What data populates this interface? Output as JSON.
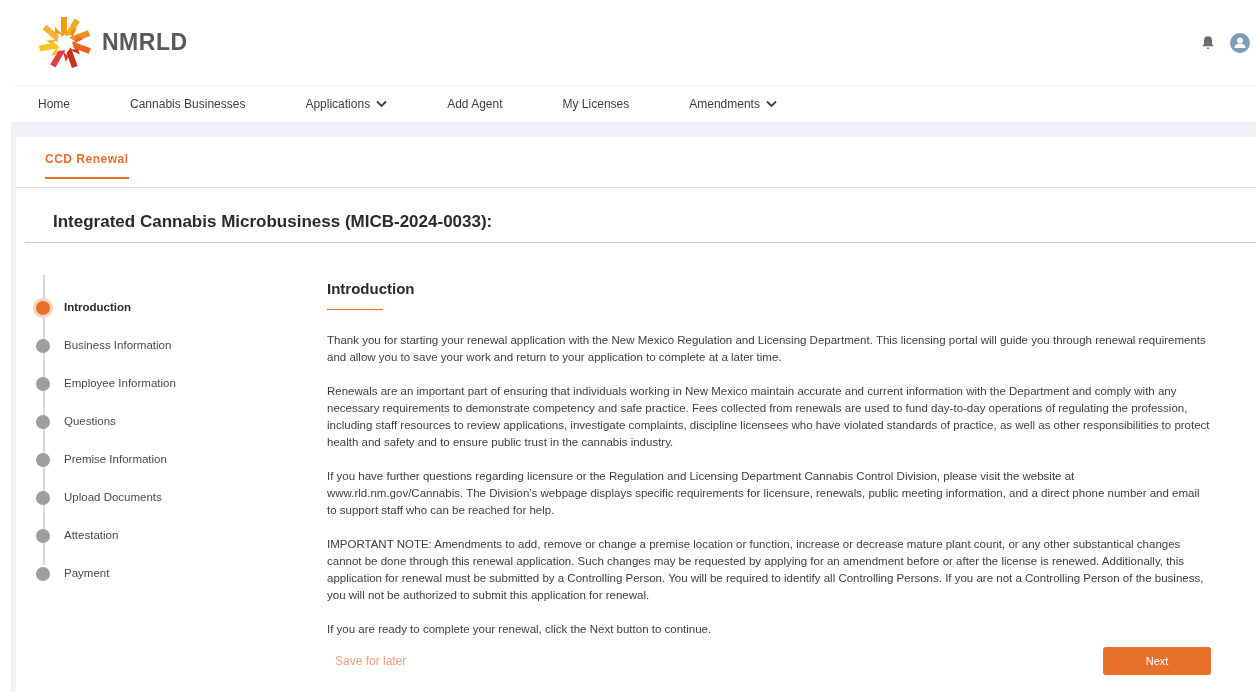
{
  "header": {
    "logo_text": "NMRLD"
  },
  "nav": [
    {
      "label": "Home",
      "dropdown": false
    },
    {
      "label": "Cannabis Businesses",
      "dropdown": false
    },
    {
      "label": "Applications",
      "dropdown": true
    },
    {
      "label": "Add Agent",
      "dropdown": false
    },
    {
      "label": "My Licenses",
      "dropdown": false
    },
    {
      "label": "Amendments",
      "dropdown": true
    }
  ],
  "tabs": [
    {
      "label": "CCD Renewal",
      "selected": true
    }
  ],
  "page_title": "Integrated Cannabis Microbusiness (MICB-2024-0033):",
  "steps": [
    {
      "label": "Introduction",
      "selected": true
    },
    {
      "label": "Business Information",
      "selected": false
    },
    {
      "label": "Employee Information",
      "selected": false
    },
    {
      "label": "Questions",
      "selected": false
    },
    {
      "label": "Premise Information",
      "selected": false
    },
    {
      "label": "Upload Documents",
      "selected": false
    },
    {
      "label": "Attestation",
      "selected": false
    },
    {
      "label": "Payment",
      "selected": false
    }
  ],
  "section": {
    "heading": "Introduction",
    "paragraphs": [
      "Thank you for starting your renewal application with the New Mexico Regulation and Licensing Department. This licensing portal will guide you through renewal requirements and allow you to save your work and return to your application to complete at a later time.",
      "Renewals are an important part of ensuring that individuals working in New Mexico maintain accurate and current information with the Department and comply with any necessary requirements to demonstrate competency and safe practice. Fees collected from renewals are used to fund day-to-day operations of regulating the profession, including staff resources to review applications, investigate complaints, discipline licensees who have violated standards of practice, as well as other responsibilities to protect health and safety and to ensure public trust in the cannabis industry.",
      "If you have further questions regarding licensure or the Regulation and Licensing Department Cannabis Control Division, please visit the website at www.rld.nm.gov/Cannabis. The Division's webpage displays specific requirements for licensure, renewals, public meeting information, and a direct phone number and email to support staff who can be reached for help.",
      "IMPORTANT NOTE: Amendments to add, remove or change a premise location or function, increase or decrease mature plant count, or any other substantical changes cannot be done through this renewal application. Such changes may be requested by applying for an amendment before or after the license is renewed. Additionally, this application for renewal must be submitted by a Controlling Person. You will be required to identify all Controlling Persons. If you are not a Controlling Person of the business, you will not be authorized to submit this application for renewal.",
      "If you are ready to complete your renewal, click the Next button to continue."
    ]
  },
  "actions": {
    "save_link": "Save for later",
    "next_button": "Next"
  }
}
